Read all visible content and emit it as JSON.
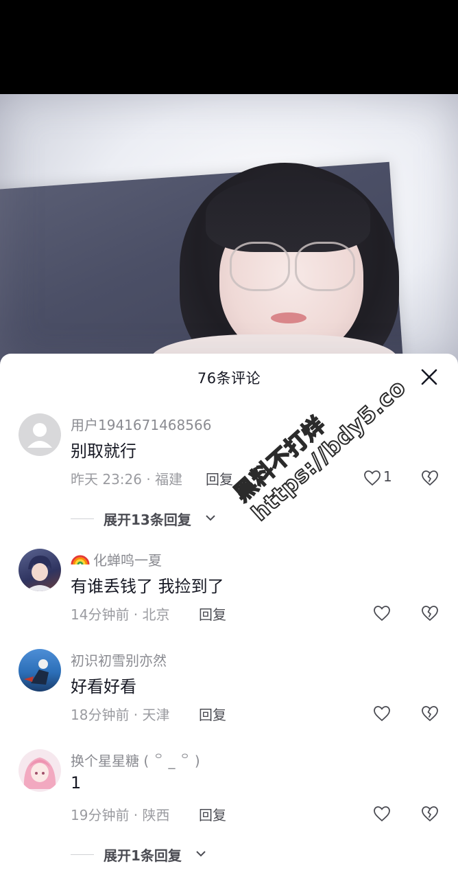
{
  "sheet": {
    "title": "76条评论"
  },
  "comments": [
    {
      "username": "用户1941671468566",
      "text": "别取就行",
      "meta": "昨天 23:26 · 福建",
      "reply_label": "回复",
      "like_count": "1",
      "expand_label": "展开13条回复"
    },
    {
      "username_prefix_icon": "rainbow-icon",
      "username": "化蝉鸣一夏",
      "text": "有谁丢钱了 我捡到了",
      "meta": "14分钟前 · 北京",
      "reply_label": "回复"
    },
    {
      "username": "初识初雪别亦然",
      "text": "好看好看",
      "meta": "18分钟前 · 天津",
      "reply_label": "回复"
    },
    {
      "username": "换个星星糖 ( ꒪ _ ꒪ )",
      "text": "1",
      "meta": "19分钟前 · 陕西",
      "reply_label": "回复",
      "expand_label": "展开1条回复"
    }
  ],
  "watermark": {
    "line1": "黑料不打烊",
    "line2": "https://bdy5.co"
  },
  "colors": {
    "sheet_bg": "#ffffff",
    "text_primary": "#161823",
    "text_secondary": "#8a8b91"
  }
}
